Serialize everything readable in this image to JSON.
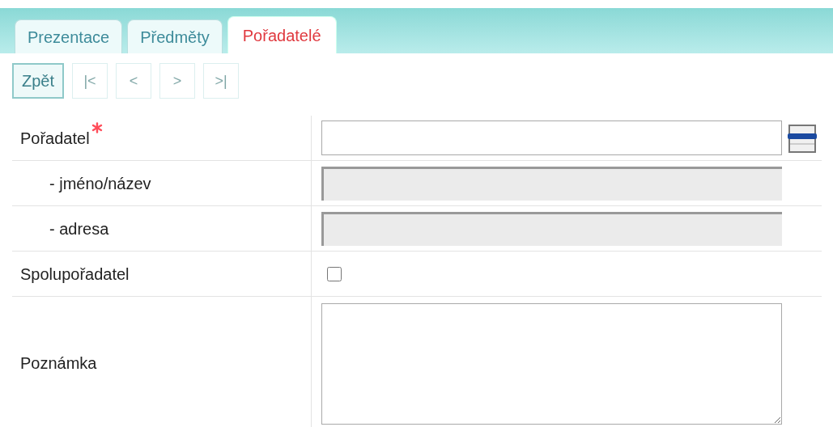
{
  "tabs": [
    {
      "label": "Prezentace",
      "selected": false
    },
    {
      "label": "Předměty",
      "selected": false
    },
    {
      "label": "Pořadatelé",
      "selected": true
    }
  ],
  "toolbar": [
    {
      "label": "Zpět",
      "disabled": false
    },
    {
      "label": "|<",
      "disabled": true
    },
    {
      "label": "<",
      "disabled": true
    },
    {
      "label": ">",
      "disabled": true
    },
    {
      "label": ">|",
      "disabled": true
    }
  ],
  "form": [
    {
      "kind": "lookup",
      "label": "Pořadatel",
      "required": true,
      "indent": false
    },
    {
      "kind": "readonly",
      "label": "- jméno/název",
      "required": false,
      "indent": true
    },
    {
      "kind": "readonly",
      "label": "- adresa",
      "required": false,
      "indent": true
    },
    {
      "kind": "checkbox",
      "label": "Spolupořadatel",
      "required": false,
      "indent": false,
      "checked": false
    },
    {
      "kind": "textarea",
      "label": "Poznámka",
      "required": false,
      "indent": false
    }
  ]
}
